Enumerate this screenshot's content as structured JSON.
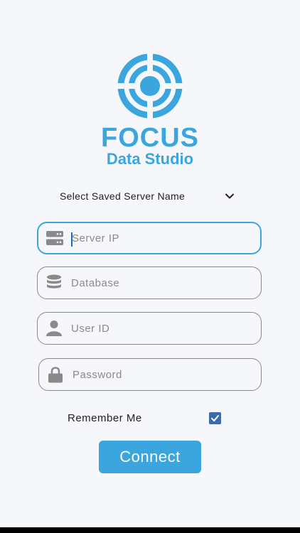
{
  "brand": {
    "title": "FOCUS",
    "subtitle": "Data Studio",
    "logo_icon": "target-logo-icon",
    "color": "#3aa6dd"
  },
  "server_select": {
    "label": "Select Saved Server Name",
    "icon": "chevron-down-icon"
  },
  "fields": {
    "server_ip": {
      "placeholder": "Server IP",
      "value": "",
      "icon": "server-icon",
      "focused": true
    },
    "database": {
      "placeholder": "Database",
      "value": "",
      "icon": "database-icon"
    },
    "user_id": {
      "placeholder": "User ID",
      "value": "",
      "icon": "user-icon"
    },
    "password": {
      "placeholder": "Password",
      "value": "",
      "icon": "lock-icon"
    }
  },
  "remember_me": {
    "label": "Remember Me",
    "checked": true
  },
  "connect_button": {
    "label": "Connect"
  },
  "colors": {
    "accent": "#3aa6dd",
    "checkbox": "#3d6aa8",
    "background": "#f6f7fb"
  }
}
